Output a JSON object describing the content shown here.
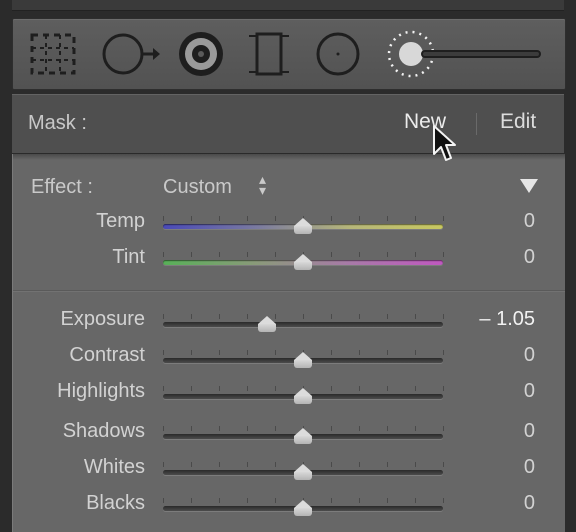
{
  "toolbar": {
    "tools": [
      {
        "icon": "crop-overlay-icon",
        "active": false
      },
      {
        "icon": "spot-removal-icon",
        "active": false
      },
      {
        "icon": "red-eye-icon",
        "active": false
      },
      {
        "icon": "graduated-filter-icon",
        "active": false
      },
      {
        "icon": "radial-filter-icon",
        "active": false
      },
      {
        "icon": "adjustment-brush-icon",
        "active": true
      }
    ]
  },
  "mask": {
    "label": "Mask :",
    "new_label": "New",
    "edit_label": "Edit"
  },
  "effect": {
    "label": "Effect :",
    "value": "Custom"
  },
  "sliders": [
    {
      "key": "temp",
      "label": "Temp",
      "value": "0",
      "position": 0.5
    },
    {
      "key": "tint",
      "label": "Tint",
      "value": "0",
      "position": 0.5
    },
    {
      "key": "exposure",
      "label": "Exposure",
      "value": "– 1.05",
      "position": 0.37
    },
    {
      "key": "contrast",
      "label": "Contrast",
      "value": "0",
      "position": 0.5
    },
    {
      "key": "highlights",
      "label": "Highlights",
      "value": "0",
      "position": 0.5
    },
    {
      "key": "shadows",
      "label": "Shadows",
      "value": "0",
      "position": 0.5
    },
    {
      "key": "whites",
      "label": "Whites",
      "value": "0",
      "position": 0.5
    },
    {
      "key": "blacks",
      "label": "Blacks",
      "value": "0",
      "position": 0.5
    }
  ],
  "colors": {
    "panel": "#676767",
    "toolbar": "#575757",
    "text": "#d2d2d2"
  }
}
